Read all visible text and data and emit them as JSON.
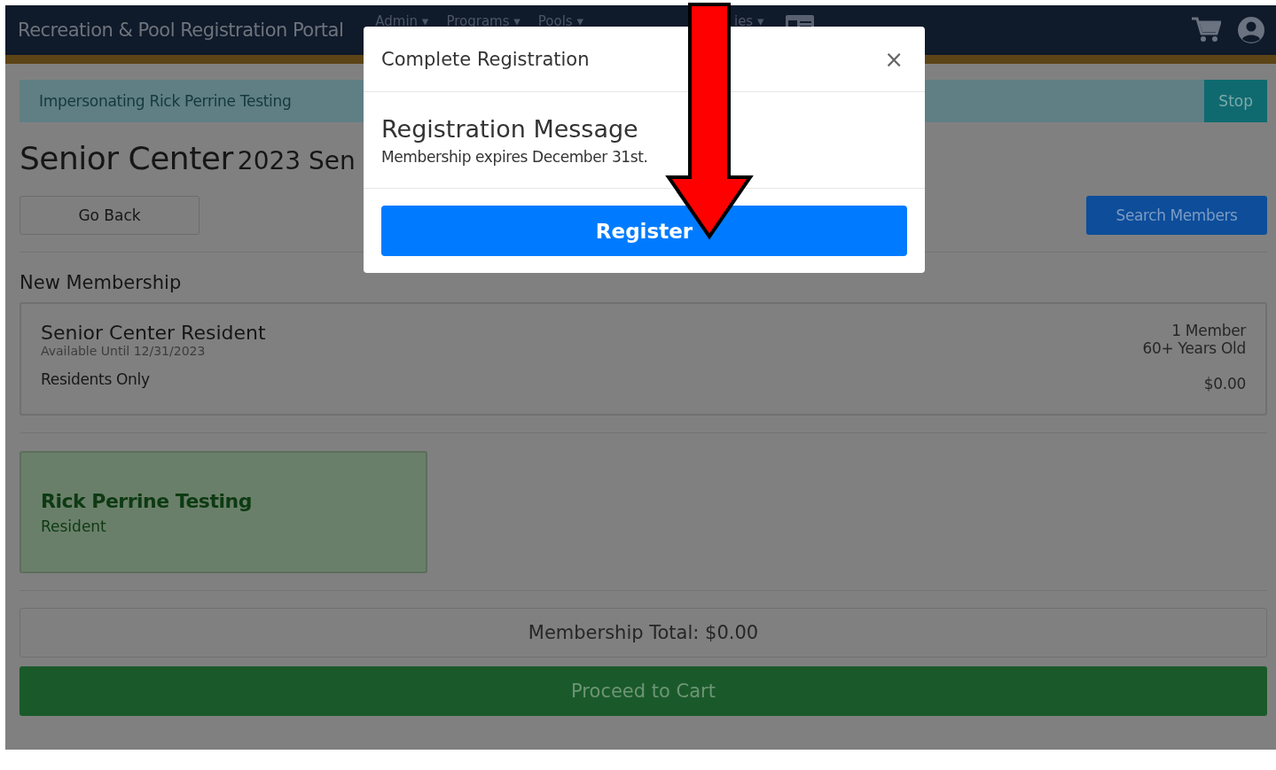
{
  "navbar": {
    "brand": "Recreation & Pool Registration Portal",
    "menus": [
      {
        "label": "Admin",
        "caret": "▾"
      },
      {
        "label": "Programs",
        "caret": "▾"
      },
      {
        "label": "Pools",
        "caret": "▾"
      },
      {
        "label": "ies",
        "caret": "▾"
      }
    ]
  },
  "impersonation": {
    "text": "Impersonating Rick Perrine Testing",
    "button": "Stop"
  },
  "page_title": {
    "main": "Senior Center",
    "sub": "2023 Sen"
  },
  "buttons": {
    "back": "Go Back",
    "search": "Search Members"
  },
  "section_title": "New Membership",
  "membership": {
    "name": "Senior Center Resident",
    "availability": "Available Until 12/31/2023",
    "restriction": "Residents Only",
    "members": "1 Member",
    "age": "60+ Years Old",
    "price": "$0.00"
  },
  "member_card": {
    "name": "Rick Perrine Testing",
    "type": "Resident"
  },
  "total": "Membership Total: $0.00",
  "proceed": "Proceed to Cart",
  "modal": {
    "title": "Complete Registration",
    "close": "×",
    "heading": "Registration Message",
    "message": "Membership expires December 31st.",
    "button": "Register"
  }
}
